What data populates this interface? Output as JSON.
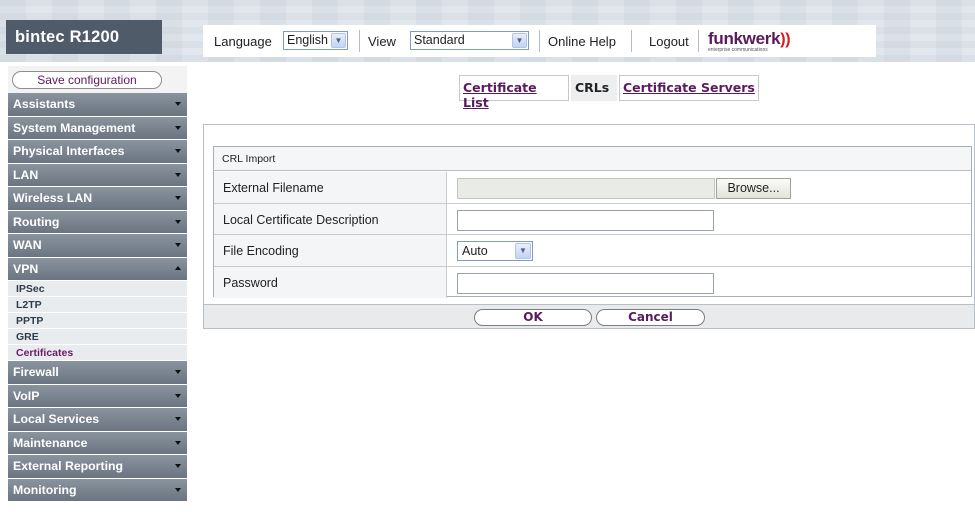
{
  "header": {
    "brand": "bintec R1200",
    "language_label": "Language",
    "language_value": "English",
    "view_label": "View",
    "view_value": "Standard",
    "online_help": "Online Help",
    "logout": "Logout",
    "logo_text": "funkwerk",
    "logo_sub": "enterprise communications"
  },
  "sidebar": {
    "save_label": "Save configuration",
    "items": [
      {
        "label": "Assistants"
      },
      {
        "label": "System Management"
      },
      {
        "label": "Physical Interfaces"
      },
      {
        "label": "LAN"
      },
      {
        "label": "Wireless LAN"
      },
      {
        "label": "Routing"
      },
      {
        "label": "WAN"
      },
      {
        "label": "VPN",
        "expanded": true
      },
      {
        "label": "Firewall"
      },
      {
        "label": "VoIP"
      },
      {
        "label": "Local Services"
      },
      {
        "label": "Maintenance"
      },
      {
        "label": "External Reporting"
      },
      {
        "label": "Monitoring"
      }
    ],
    "vpn_sub": [
      "IPSec",
      "L2TP",
      "PPTP",
      "GRE",
      "Certificates"
    ],
    "active_sub": "Certificates"
  },
  "tabs": [
    {
      "label": "Certificate List",
      "active": false
    },
    {
      "label": "CRLs",
      "active": true
    },
    {
      "label": "Certificate Servers",
      "active": false
    }
  ],
  "form": {
    "section_title": "CRL Import",
    "fields": {
      "external_filename": {
        "label": "External Filename",
        "value": "",
        "button": "Browse..."
      },
      "local_description": {
        "label": "Local Certificate Description",
        "value": ""
      },
      "file_encoding": {
        "label": "File Encoding",
        "value": "Auto"
      },
      "password": {
        "label": "Password",
        "value": ""
      }
    }
  },
  "buttons": {
    "ok": "OK",
    "cancel": "Cancel"
  },
  "colors": {
    "accent": "#5a1a5e",
    "menu_bg": "#7c8691",
    "logo_red": "#d9181a"
  }
}
